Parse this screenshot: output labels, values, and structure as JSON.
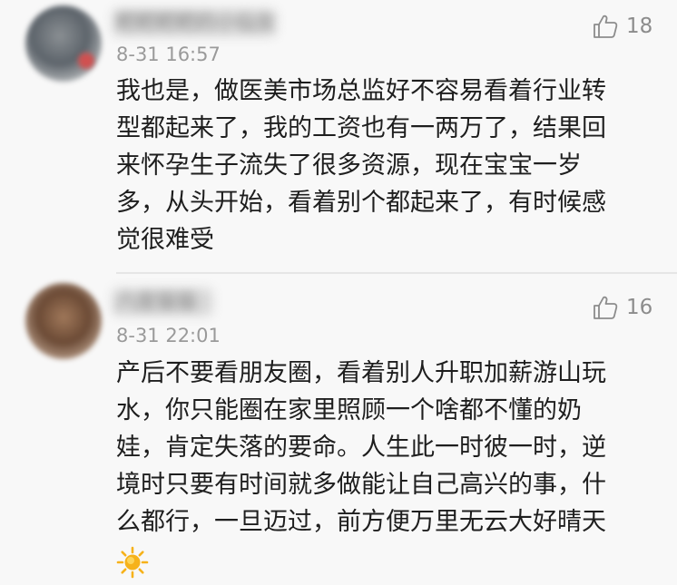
{
  "comments": [
    {
      "username": "粑粑粑粑的小仙女",
      "timestamp": "8-31 16:57",
      "likes": "18",
      "like_icon": "thumbs-up-icon",
      "text": "我也是，做医美市场总监好不容易看着行业转\n型都起来了，我的工资也有一两万了，结果回\n来怀孕生子流失了很多资源，现在宝宝一岁\n多，从头开始，看着别个都起来了，有时候感\n觉很难受"
    },
    {
      "username": "六度猫猫",
      "timestamp": "8-31 22:01",
      "likes": "16",
      "like_icon": "thumbs-up-icon",
      "text": "产后不要看朋友圈，看着别人升职加薪游山玩\n水，你只能圈在家里照顾一个啥都不懂的奶\n娃，肯定失落的要命。人生此一时彼一时，逆\n境时只要有时间就多做能让自己高兴的事，什\n么都行，一旦迈过，前方便万里无云大好晴天",
      "emoji": "sun-emoji-icon"
    }
  ],
  "colors": {
    "background": "#f8f8f8",
    "text": "#1e1e1e",
    "meta": "#9a9a9a",
    "divider": "#e6e6e6",
    "sun": "#f6b21a"
  }
}
